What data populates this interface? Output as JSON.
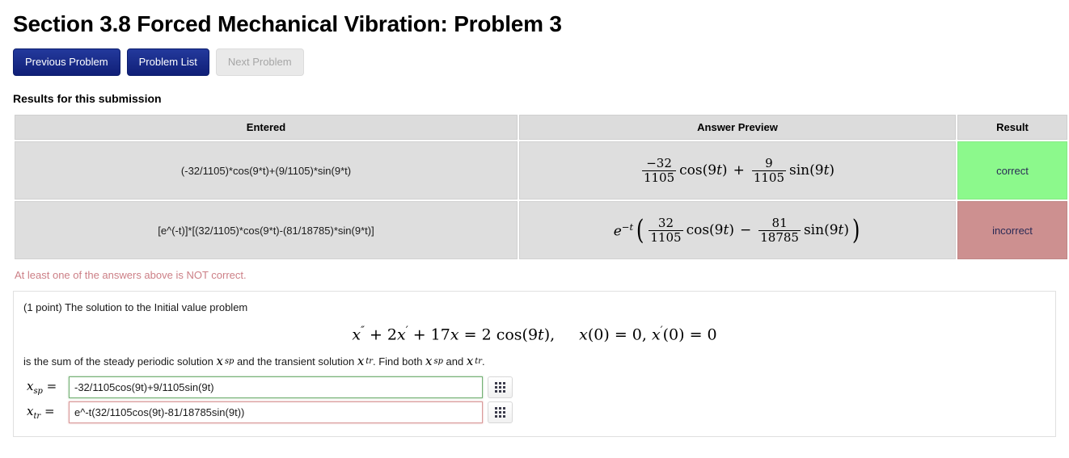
{
  "header": {
    "title": "Section 3.8 Forced Mechanical Vibration: Problem 3"
  },
  "nav": {
    "previous_label": "Previous Problem",
    "list_label": "Problem List",
    "next_label": "Next Problem"
  },
  "results": {
    "heading": "Results for this submission",
    "columns": {
      "entered": "Entered",
      "preview": "Answer Preview",
      "result": "Result"
    },
    "rows": [
      {
        "entered": "(-32/1105)*cos(9*t)+(9/1105)*sin(9*t)",
        "preview_text": "-32/1105 cos(9t) + 9/1105 sin(9t)",
        "result": "correct",
        "result_color": "#8cf98c"
      },
      {
        "entered": "[e^(-t)]*[(32/1105)*cos(9*t)-(81/18785)*sin(9*t)]",
        "preview_text": "e^-t ( 32/1105 cos(9t) - 81/18785 sin(9t) )",
        "result": "incorrect",
        "result_color": "#cd9090"
      }
    ],
    "error_message": "At least one of the answers above is NOT correct.",
    "error_color": "#cc7f86"
  },
  "preview_math": {
    "row1": {
      "frac1_num": "−32",
      "frac1_den": "1105",
      "trig1": "cos(9",
      "trig1_var": "t",
      "trig1_close": ")",
      "operator": "+",
      "frac2_num": "9",
      "frac2_den": "1105",
      "trig2": "sin(9",
      "trig2_var": "t",
      "trig2_close": ")"
    },
    "row2": {
      "exp_base": "e",
      "exp_power": "−t",
      "open_paren": "(",
      "frac1_num": "32",
      "frac1_den": "1105",
      "trig1": "cos(9",
      "trig1_var": "t",
      "trig1_close": ")",
      "operator": "−",
      "frac2_num": "81",
      "frac2_den": "18785",
      "trig2": "sin(9",
      "trig2_var": "t",
      "trig2_close": ")",
      "close_paren": ")"
    }
  },
  "problem": {
    "points_text": "(1 point) The solution to the Initial value problem",
    "equation": {
      "x1": "x",
      "primes1": "″",
      "plus1": "+ 2",
      "x2": "x",
      "primes2": "′",
      "plus2": "+ 17",
      "x3": "x",
      "equals": "= 2 cos(9",
      "t": "t",
      "close": "),",
      "ic1_x": "x",
      "ic1": "(0) = 0,",
      "ic2_x": "x",
      "ic2_prime": "′",
      "ic2": "(0) = 0"
    },
    "description": {
      "part1": "is the sum of the steady periodic solution ",
      "var1": "x",
      "var1_sub": "sp",
      "part2": " and the transient solution ",
      "var2": "x",
      "var2_sub": "tr",
      "part3": ". Find both ",
      "var3": "x",
      "var3_sub": "sp",
      "part4": " and ",
      "var4": "x",
      "var4_sub": "tr",
      "part5": "."
    },
    "answers": [
      {
        "label_var": "x",
        "label_sub": "sp",
        "equals": "=",
        "value": "-32/1105cos(9t)+9/1105sin(9t)",
        "state": "correct",
        "keypad_icon": "grid-keypad-icon"
      },
      {
        "label_var": "x",
        "label_sub": "tr",
        "equals": "=",
        "value": "e^-t(32/1105cos(9t)-81/18785sin(9t))",
        "state": "incorrect",
        "keypad_icon": "grid-keypad-icon"
      }
    ]
  }
}
